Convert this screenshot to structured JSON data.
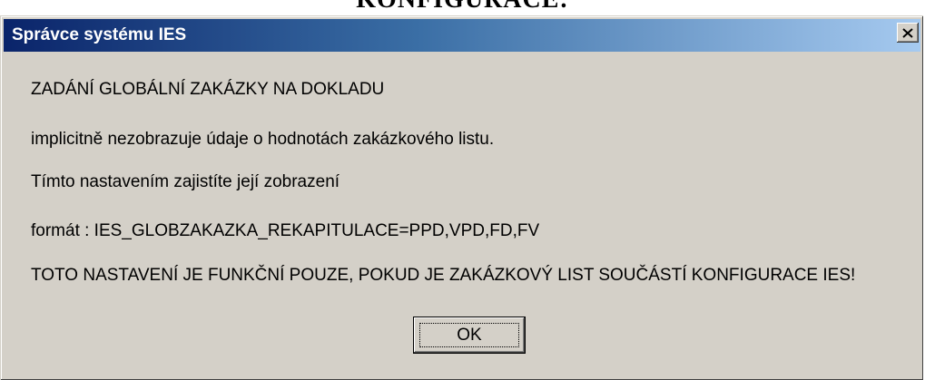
{
  "document": {
    "heading": "KONFIGURACE:"
  },
  "dialog": {
    "title": "Správce systému IES",
    "close_icon": "close-icon",
    "messages": [
      "ZADÁNÍ GLOBÁLNÍ ZAKÁZKY NA DOKLADU",
      "implicitně nezobrazuje údaje o hodnotách zakázkového listu.",
      "Tímto nastavením zajistíte její zobrazení",
      "formát : IES_GLOBZAKAZKA_REKAPITULACE=PPD,VPD,FD,FV",
      "TOTO NASTAVENÍ JE FUNKČNÍ POUZE, POKUD JE ZAKÁZKOVÝ LIST SOUČÁSTÍ KONFIGURACE IES!"
    ],
    "ok_label": "OK"
  },
  "colors": {
    "titlebar_start": "#0a246a",
    "titlebar_end": "#a6caf0",
    "dialog_face": "#d4d0c8"
  }
}
